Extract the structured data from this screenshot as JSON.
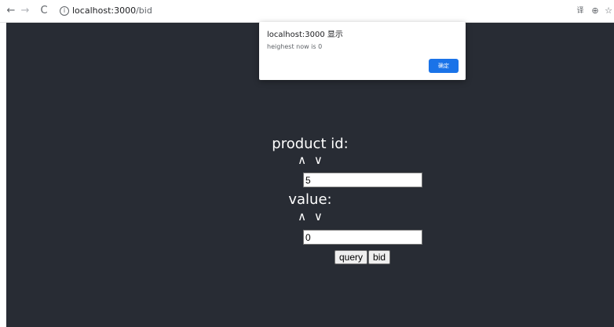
{
  "browser": {
    "nav": {
      "back_icon": "←",
      "forward_icon": "→",
      "reload_icon": "C"
    },
    "url": {
      "host": "localhost:3000",
      "path": "/bid"
    },
    "info_icon": "i",
    "translate_icon": "译",
    "zoom_icon": "⊕",
    "star_icon": "☆"
  },
  "dialog": {
    "title": "localhost:3000 显示",
    "message": "heighest now is 0",
    "ok_label": "确定",
    "ok_color": "#1a73e8"
  },
  "page": {
    "background": "#282c34",
    "product": {
      "label": "product id:",
      "arrow_up": "∧",
      "arrow_down": "∨",
      "value": "5"
    },
    "value_field": {
      "label": "value:",
      "arrow_up": "∧",
      "arrow_down": "∨",
      "value": "0"
    },
    "buttons": {
      "query_label": "query",
      "bid_label": "bid"
    }
  }
}
